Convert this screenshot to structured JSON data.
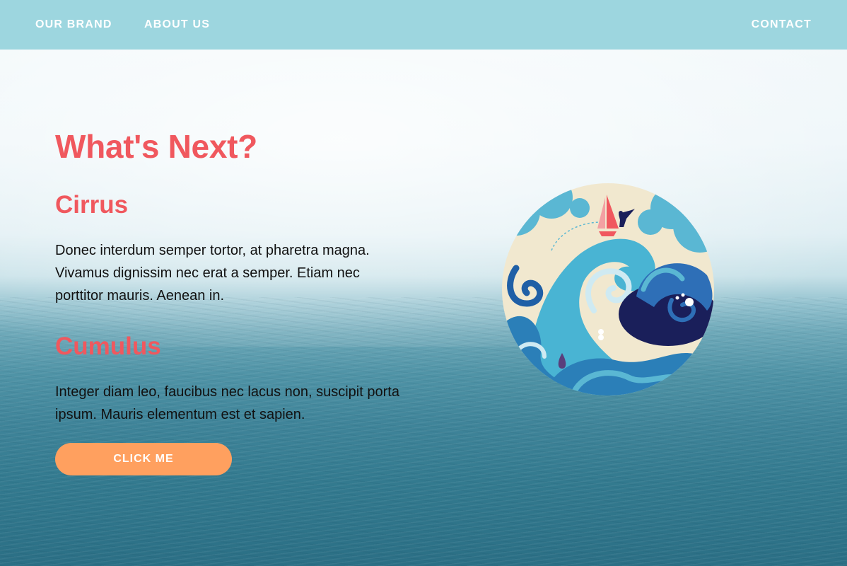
{
  "nav": {
    "brand": "OUR BRAND",
    "about": "ABOUT US",
    "contact": "CONTACT"
  },
  "hero": {
    "headline": "What's Next?",
    "sections": [
      {
        "title": "Cirrus",
        "body": "Donec interdum semper tortor, at pharetra magna. Vivamus dignissim nec erat a semper. Etiam nec porttitor mauris. Aenean in."
      },
      {
        "title": "Cumulus",
        "body": "Integer diam leo, faucibus nec lacus non, suscipit porta ipsum. Mauris elementum est et sapien."
      }
    ],
    "cta_label": "CLICK ME"
  },
  "illustration": {
    "icon": "waves-sailboat-illustration"
  },
  "colors": {
    "accent": "#f0585e",
    "button": "#ffa05f",
    "nav_bar": "#9dd6df",
    "nav_text": "#ffffff",
    "body_text": "#111111"
  }
}
